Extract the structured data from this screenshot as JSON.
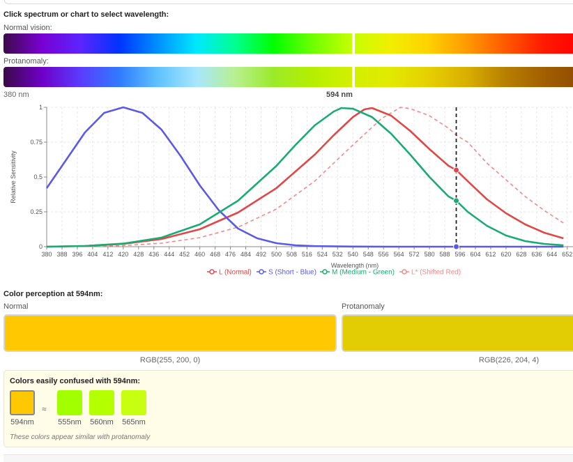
{
  "header": {
    "instruction": "Click spectrum or chart to select wavelength:",
    "normal_label": "Normal vision:",
    "protan_label": "Protanomaly:",
    "range_start": "380 nm",
    "selected_label": "594 nm"
  },
  "spectrum": {
    "normal_colors": [
      "#3d0a4a",
      "#7a00d4",
      "#5b25ff",
      "#0033ff",
      "#0090ff",
      "#00e8ff",
      "#00ff90",
      "#00ff00",
      "#6cff00",
      "#c4ff00",
      "#f0f000",
      "#ffd200",
      "#ff9a00",
      "#ff5a00",
      "#ff1a00",
      "#ff0000"
    ],
    "protan_colors": [
      "#3b0a47",
      "#6f00c8",
      "#5a3cff",
      "#2f7bff",
      "#5fc2ff",
      "#a8e6ff",
      "#b8f090",
      "#9bea2a",
      "#b5ef00",
      "#d2f000",
      "#e2ea00",
      "#e6d000",
      "#d9b000",
      "#b88000",
      "#a26000",
      "#8f4a00"
    ],
    "selected_fraction": 0.605
  },
  "chart_data": {
    "type": "line",
    "title": "",
    "xlabel": "Wavelength (nm)",
    "ylabel": "Relative Sensitivity",
    "xlim": [
      380,
      655
    ],
    "ylim": [
      0,
      1
    ],
    "x_ticks": [
      380,
      388,
      396,
      404,
      412,
      420,
      428,
      436,
      444,
      452,
      460,
      468,
      476,
      484,
      492,
      500,
      508,
      516,
      524,
      532,
      540,
      548,
      556,
      564,
      572,
      580,
      588,
      596,
      604,
      612,
      620,
      628,
      636,
      644,
      652
    ],
    "y_ticks": [
      0,
      0.25,
      0.5,
      0.75,
      1
    ],
    "y_tick_labels": [
      "0",
      "0.25",
      "0.5",
      "0.75",
      "1"
    ],
    "grid": true,
    "legend_position": "bottom",
    "selected_wavelength": 594,
    "series": [
      {
        "name": "L (Normal)",
        "color": "#e04848",
        "dash": false,
        "x": [
          380,
          400,
          420,
          440,
          460,
          480,
          500,
          520,
          530,
          540,
          546,
          550,
          560,
          570,
          580,
          590,
          594,
          600,
          610,
          620,
          630,
          640,
          650
        ],
        "y": [
          0.0,
          0.005,
          0.02,
          0.055,
          0.125,
          0.245,
          0.42,
          0.66,
          0.8,
          0.93,
          0.985,
          0.995,
          0.94,
          0.83,
          0.7,
          0.58,
          0.55,
          0.47,
          0.34,
          0.24,
          0.16,
          0.1,
          0.06
        ]
      },
      {
        "name": "S (Short - Blue)",
        "color": "#5a5ae6",
        "dash": false,
        "x": [
          380,
          390,
          400,
          410,
          420,
          430,
          440,
          450,
          460,
          470,
          480,
          490,
          500,
          510,
          520,
          540,
          560,
          580,
          600,
          650
        ],
        "y": [
          0.42,
          0.62,
          0.82,
          0.96,
          1.0,
          0.96,
          0.84,
          0.65,
          0.44,
          0.26,
          0.13,
          0.06,
          0.025,
          0.01,
          0.004,
          0.001,
          0.0,
          0.0,
          0.0,
          0.0
        ]
      },
      {
        "name": "M (Medium - Green)",
        "color": "#1aaa73",
        "dash": false,
        "x": [
          380,
          400,
          420,
          440,
          460,
          480,
          500,
          510,
          520,
          530,
          534,
          540,
          550,
          560,
          570,
          580,
          590,
          594,
          600,
          610,
          620,
          630,
          640,
          650
        ],
        "y": [
          0.0,
          0.005,
          0.022,
          0.065,
          0.16,
          0.33,
          0.58,
          0.73,
          0.87,
          0.97,
          0.995,
          0.99,
          0.93,
          0.81,
          0.66,
          0.5,
          0.36,
          0.33,
          0.25,
          0.15,
          0.08,
          0.04,
          0.02,
          0.01
        ]
      },
      {
        "name": "L* (Shifted Red)",
        "color": "#f08a8a",
        "dash": true,
        "x": [
          380,
          400,
          420,
          440,
          460,
          480,
          500,
          520,
          540,
          555,
          565,
          570,
          580,
          590,
          594,
          600,
          610,
          620,
          630,
          640,
          650
        ],
        "y": [
          0.0,
          0.002,
          0.008,
          0.025,
          0.065,
          0.14,
          0.27,
          0.47,
          0.73,
          0.92,
          1.0,
          0.99,
          0.94,
          0.85,
          0.8,
          0.75,
          0.6,
          0.48,
          0.36,
          0.26,
          0.17
        ]
      }
    ],
    "markers": [
      {
        "series": "L (Normal)",
        "x": 594,
        "y": 0.55,
        "color": "#e04848"
      },
      {
        "series": "M (Medium - Green)",
        "x": 594,
        "y": 0.33,
        "color": "#1aaa73"
      },
      {
        "series": "S (Short - Blue)",
        "x": 594,
        "y": 0.0,
        "color": "#5a5ae6"
      }
    ]
  },
  "perception": {
    "heading": "Color perception at 594nm:",
    "normal_label": "Normal",
    "protan_label": "Protanomaly",
    "normal_color": "#ffc800",
    "protan_color": "#e2cc04",
    "normal_rgb": "RGB(255, 200, 0)",
    "protan_rgb": "RGB(226, 204, 4)"
  },
  "confusion": {
    "title": "Colors easily confused with 594nm:",
    "approx_symbol": "≈",
    "base": {
      "label": "594nm",
      "color": "#ffc800"
    },
    "items": [
      {
        "label": "555nm",
        "color": "#a2ff00"
      },
      {
        "label": "560nm",
        "color": "#b4ff00"
      },
      {
        "label": "565nm",
        "color": "#c8ff10"
      }
    ],
    "note": "These colors appear similar with protanomaly"
  }
}
